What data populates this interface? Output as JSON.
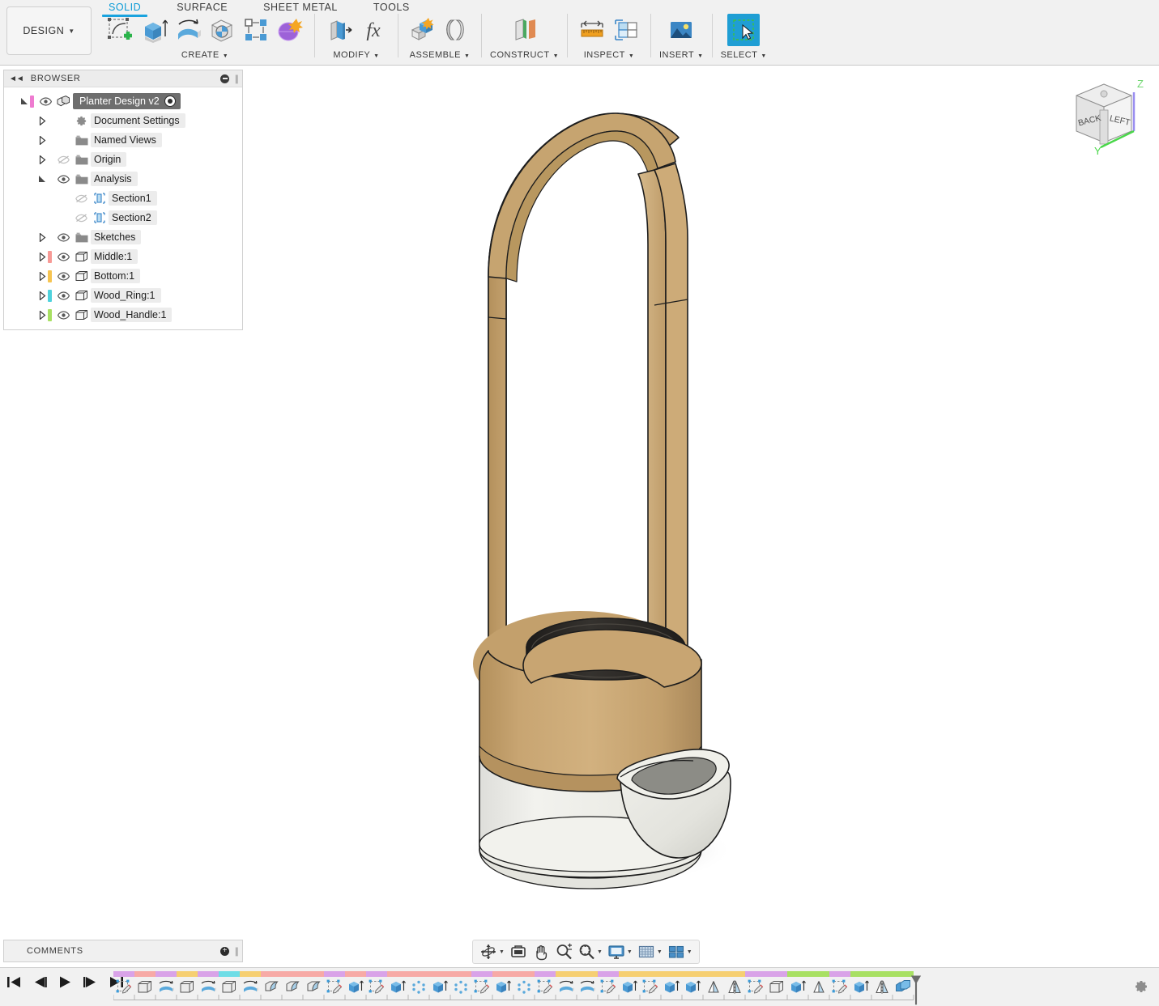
{
  "app": {
    "design_button": "DESIGN",
    "tabs": [
      {
        "label": "SOLID",
        "active": true
      },
      {
        "label": "SURFACE",
        "active": false
      },
      {
        "label": "SHEET METAL",
        "active": false
      },
      {
        "label": "TOOLS",
        "active": false
      }
    ],
    "ribbon_groups": [
      {
        "label": "CREATE",
        "has_caret": true,
        "icons": [
          {
            "name": "create-sketch-icon",
            "glyph": "sketch-plus"
          },
          {
            "name": "extrude-icon",
            "glyph": "extrude"
          },
          {
            "name": "revolve-icon",
            "glyph": "revolve"
          },
          {
            "name": "hole-icon",
            "glyph": "hole"
          },
          {
            "name": "pattern-icon",
            "glyph": "pattern"
          },
          {
            "name": "create-form-icon",
            "glyph": "form"
          }
        ]
      },
      {
        "label": "MODIFY",
        "has_caret": true,
        "icons": [
          {
            "name": "press-pull-icon",
            "glyph": "presspull"
          },
          {
            "name": "change-parameters-icon",
            "glyph": "fx"
          }
        ]
      },
      {
        "label": "ASSEMBLE",
        "has_caret": true,
        "icons": [
          {
            "name": "new-component-icon",
            "glyph": "newcomponent"
          },
          {
            "name": "joint-icon",
            "glyph": "joint"
          }
        ]
      },
      {
        "label": "CONSTRUCT",
        "has_caret": true,
        "icons": [
          {
            "name": "offset-plane-icon",
            "glyph": "offsetplane"
          }
        ]
      },
      {
        "label": "INSPECT",
        "has_caret": true,
        "icons": [
          {
            "name": "measure-icon",
            "glyph": "measure"
          },
          {
            "name": "section-analysis-icon",
            "glyph": "sectionanalysis"
          }
        ]
      },
      {
        "label": "INSERT",
        "has_caret": true,
        "icons": [
          {
            "name": "insert-image-icon",
            "glyph": "image"
          }
        ]
      },
      {
        "label": "SELECT",
        "has_caret": true,
        "icons": [
          {
            "name": "select-tool-icon",
            "glyph": "select",
            "selected": true
          }
        ]
      }
    ]
  },
  "browser": {
    "title": "BROWSER",
    "collapse_icon": "collapse-left-icon",
    "minimize_icon": "minimize-icon",
    "nodes": [
      {
        "label": "Planter Design v2",
        "depth": 0,
        "expanded": true,
        "arrow": "down",
        "eye": "visible",
        "icon": "component-icon",
        "color": "#ee7bd0",
        "selected": true,
        "activated": true
      },
      {
        "label": "Document Settings",
        "depth": 1,
        "expanded": false,
        "arrow": "right",
        "eye": "none",
        "icon": "gear-icon",
        "color": ""
      },
      {
        "label": "Named Views",
        "depth": 1,
        "expanded": false,
        "arrow": "right",
        "eye": "none",
        "icon": "folder-icon",
        "color": ""
      },
      {
        "label": "Origin",
        "depth": 1,
        "expanded": false,
        "arrow": "right",
        "eye": "hidden",
        "icon": "folder-icon",
        "color": ""
      },
      {
        "label": "Analysis",
        "depth": 1,
        "expanded": true,
        "arrow": "down",
        "eye": "visible",
        "icon": "folder-icon",
        "color": ""
      },
      {
        "label": "Section1",
        "depth": 2,
        "expanded": false,
        "arrow": "none",
        "eye": "hidden",
        "icon": "section-icon",
        "color": ""
      },
      {
        "label": "Section2",
        "depth": 2,
        "expanded": false,
        "arrow": "none",
        "eye": "hidden",
        "icon": "section-icon",
        "color": ""
      },
      {
        "label": "Sketches",
        "depth": 1,
        "expanded": false,
        "arrow": "right",
        "eye": "visible",
        "icon": "folder-icon",
        "color": ""
      },
      {
        "label": "Middle:1",
        "depth": 1,
        "expanded": false,
        "arrow": "right",
        "eye": "visible",
        "icon": "body-icon",
        "color": "#f79a96"
      },
      {
        "label": "Bottom:1",
        "depth": 1,
        "expanded": false,
        "arrow": "right",
        "eye": "visible",
        "icon": "body-icon",
        "color": "#f6c451"
      },
      {
        "label": "Wood_Ring:1",
        "depth": 1,
        "expanded": false,
        "arrow": "right",
        "eye": "visible",
        "icon": "body-icon",
        "color": "#4fd2dd"
      },
      {
        "label": "Wood_Handle:1",
        "depth": 1,
        "expanded": false,
        "arrow": "right",
        "eye": "visible",
        "icon": "body-icon",
        "color": "#a8e063"
      }
    ]
  },
  "viewcube": {
    "front_face_label": "BACK",
    "right_face_label": "LEFT",
    "axis_z": "Z",
    "axis_y": "Y",
    "axis_z_color": "#9a8ef0",
    "axis_y_color": "#4ad74a",
    "home_icon": "home-icon"
  },
  "model": {
    "name": "planter-3d-model",
    "colors": {
      "wood": "#c9a571",
      "wood_light": "#d4b485",
      "wood_dark": "#b08f5e",
      "ceramic": "#eeeee8",
      "ceramic_shade": "#dcdcd4",
      "interior_dark": "#2a2826",
      "outline": "#1c1c1c",
      "shadow": "#e2e2e2"
    }
  },
  "comments": {
    "title": "COMMENTS",
    "add_icon": "add-comment-icon"
  },
  "navbar": {
    "items": [
      {
        "name": "orbit-icon",
        "glyph": "orbit",
        "caret": true
      },
      {
        "name": "look-at-icon",
        "glyph": "lookat",
        "caret": false
      },
      {
        "name": "pan-icon",
        "glyph": "pan",
        "caret": false
      },
      {
        "name": "zoom-icon",
        "glyph": "zoom",
        "caret": false
      },
      {
        "name": "fit-icon",
        "glyph": "fit",
        "caret": true
      },
      {
        "name": "display-settings-icon",
        "glyph": "display",
        "caret": true
      },
      {
        "name": "grid-snaps-icon",
        "glyph": "grid",
        "caret": true
      },
      {
        "name": "viewports-icon",
        "glyph": "viewports",
        "caret": true
      }
    ]
  },
  "timeline": {
    "playback": [
      {
        "name": "go-to-beginning-button",
        "glyph": "skip-back"
      },
      {
        "name": "step-back-button",
        "glyph": "step-back"
      },
      {
        "name": "play-button",
        "glyph": "play"
      },
      {
        "name": "step-forward-button",
        "glyph": "step-forward"
      },
      {
        "name": "go-to-end-button",
        "glyph": "skip-end"
      }
    ],
    "settings_icon": "timeline-settings-icon",
    "marker_name": "timeline-end-marker",
    "features": [
      {
        "glyph": "sketch",
        "bar": "#d9a3e8"
      },
      {
        "glyph": "body",
        "bar": "#f7aaa6"
      },
      {
        "glyph": "revolve",
        "bar": "#d9a3e8"
      },
      {
        "glyph": "body",
        "bar": "#f6cf72"
      },
      {
        "glyph": "revolve",
        "bar": "#d9a3e8"
      },
      {
        "glyph": "body",
        "bar": "#6fdde6"
      },
      {
        "glyph": "revolve",
        "bar": "#f6cf72"
      },
      {
        "glyph": "fillet",
        "bar": "#f7aaa6"
      },
      {
        "glyph": "fillet",
        "bar": "#f7aaa6"
      },
      {
        "glyph": "fillet",
        "bar": "#f7aaa6"
      },
      {
        "glyph": "sketch",
        "bar": "#d9a3e8"
      },
      {
        "glyph": "extrude",
        "bar": "#f7aaa6"
      },
      {
        "glyph": "sketch",
        "bar": "#d9a3e8"
      },
      {
        "glyph": "extrude",
        "bar": "#f7aaa6"
      },
      {
        "glyph": "pattern",
        "bar": "#f7aaa6"
      },
      {
        "glyph": "extrude",
        "bar": "#f7aaa6"
      },
      {
        "glyph": "pattern",
        "bar": "#f7aaa6"
      },
      {
        "glyph": "sketch",
        "bar": "#d9a3e8"
      },
      {
        "glyph": "extrude",
        "bar": "#f7aaa6"
      },
      {
        "glyph": "pattern",
        "bar": "#f7aaa6"
      },
      {
        "glyph": "sketch",
        "bar": "#d9a3e8"
      },
      {
        "glyph": "revolve",
        "bar": "#f6cf72"
      },
      {
        "glyph": "revolve",
        "bar": "#f6cf72"
      },
      {
        "glyph": "sketch",
        "bar": "#d9a3e8"
      },
      {
        "glyph": "extrude",
        "bar": "#f6cf72"
      },
      {
        "glyph": "sketch",
        "bar": "#f6cf72"
      },
      {
        "glyph": "extrude",
        "bar": "#f6cf72"
      },
      {
        "glyph": "extrude",
        "bar": "#f6cf72"
      },
      {
        "glyph": "chamfer",
        "bar": "#f6cf72"
      },
      {
        "glyph": "mirror",
        "bar": "#f6cf72"
      },
      {
        "glyph": "sketch",
        "bar": "#d9a3e8"
      },
      {
        "glyph": "body",
        "bar": "#d9a3e8"
      },
      {
        "glyph": "extrude",
        "bar": "#a8e063"
      },
      {
        "glyph": "chamfer",
        "bar": "#a8e063"
      },
      {
        "glyph": "sketch",
        "bar": "#d9a3e8"
      },
      {
        "glyph": "extrude",
        "bar": "#a8e063"
      },
      {
        "glyph": "mirror",
        "bar": "#a8e063"
      },
      {
        "glyph": "combine",
        "bar": "#a8e063"
      }
    ]
  }
}
